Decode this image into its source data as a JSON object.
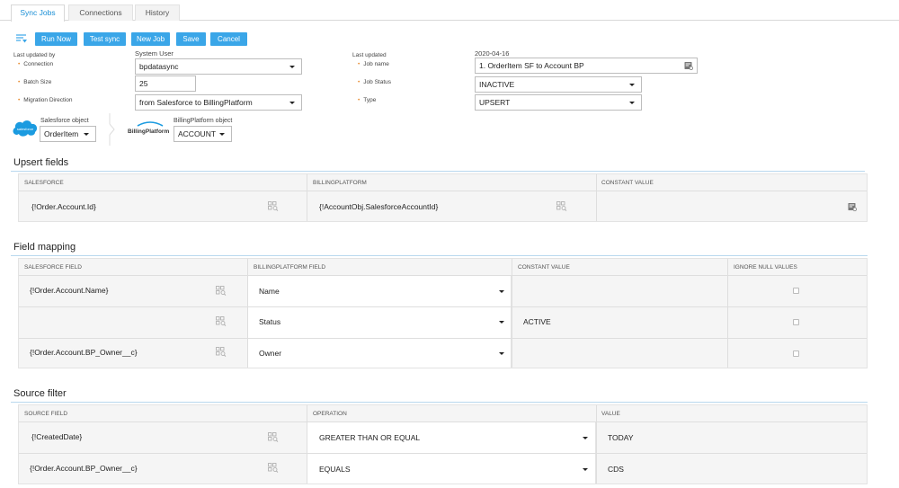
{
  "tabs": [
    {
      "label": "Sync Jobs",
      "active": true
    },
    {
      "label": "Connections",
      "active": false
    },
    {
      "label": "History",
      "active": false
    }
  ],
  "toolbar": {
    "run_now": "Run Now",
    "test_sync": "Test sync",
    "new_job": "New Job",
    "save": "Save",
    "cancel": "Cancel"
  },
  "form_left": {
    "last_updated_by_label": "Last updated by",
    "last_updated_by_value": "System User",
    "connection_label": "Connection",
    "connection_value": "bpdatasync",
    "batch_size_label": "Batch Size",
    "batch_size_value": "25",
    "migration_direction_label": "Migration Direction",
    "migration_direction_value": "from Salesforce to BillingPlatform"
  },
  "form_right": {
    "last_updated_label": "Last updated",
    "last_updated_value": "2020-04-16",
    "job_name_label": "Job name",
    "job_name_value": "1. OrderItem SF to Account BP",
    "job_status_label": "Job Status",
    "job_status_value": "INACTIVE",
    "type_label": "Type",
    "type_value": "UPSERT"
  },
  "objects": {
    "salesforce_logo_text": "salesforce",
    "salesforce_object_label": "Salesforce object",
    "salesforce_object_value": "OrderItem",
    "bp_logo_text": "BillingPlatform",
    "bp_object_label": "BillingPlatform object",
    "bp_object_value": "ACCOUNT"
  },
  "upsert_fields": {
    "title": "Upsert fields",
    "headers": [
      "SALESFORCE",
      "BILLINGPLATFORM",
      "CONSTANT VALUE"
    ],
    "row": {
      "salesforce": "{!Order.Account.Id}",
      "billingplatform": "{!AccountObj.SalesforceAccountId}",
      "constant": ""
    }
  },
  "field_mapping": {
    "title": "Field mapping",
    "headers": [
      "SALESFORCE FIELD",
      "BILLINGPLATFORM FIELD",
      "CONSTANT VALUE",
      "IGNORE NULL VALUES"
    ],
    "rows": [
      {
        "salesforce": "{!Order.Account.Name}",
        "bp": "Name",
        "constant": ""
      },
      {
        "salesforce": "",
        "bp": "Status",
        "constant": "ACTIVE"
      },
      {
        "salesforce": "{!Order.Account.BP_Owner__c}",
        "bp": "Owner",
        "constant": ""
      }
    ]
  },
  "source_filter": {
    "title": "Source filter",
    "headers": [
      "SOURCE FIELD",
      "OPERATION",
      "VALUE"
    ],
    "rows": [
      {
        "field": "{!CreatedDate}",
        "operation": "GREATER THAN OR EQUAL",
        "value": "TODAY"
      },
      {
        "field": "{!Order.Account.BP_Owner__c}",
        "operation": "EQUALS",
        "value": "CDS"
      }
    ]
  },
  "colors": {
    "accent": "#3aa6e8",
    "required_dot": "#e88b2e",
    "section_line": "#b9d8ee"
  }
}
